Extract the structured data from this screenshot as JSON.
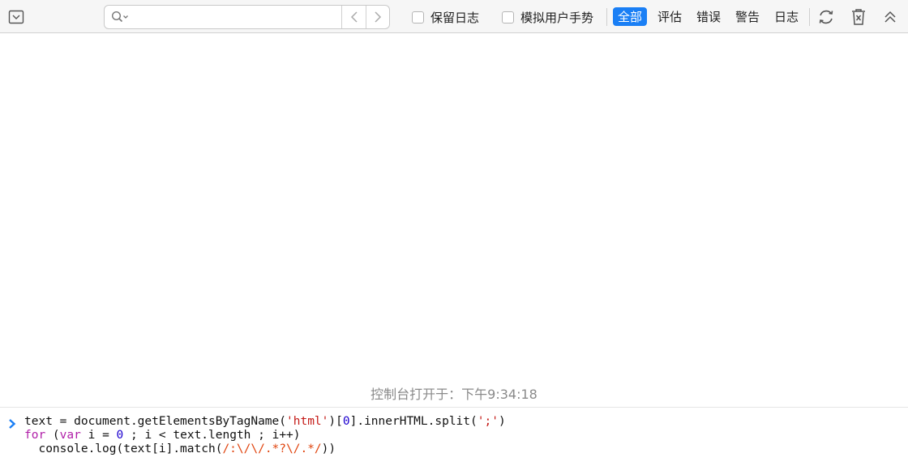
{
  "toolbar": {
    "search": {
      "value": "",
      "placeholder": ""
    },
    "preserve_log_label": "保留日志",
    "simulate_gesture_label": "模拟用户手势",
    "filters": [
      {
        "label": "全部",
        "active": true
      },
      {
        "label": "评估",
        "active": false
      },
      {
        "label": "错误",
        "active": false
      },
      {
        "label": "警告",
        "active": false
      },
      {
        "label": "日志",
        "active": false
      }
    ],
    "icons": {
      "menu": "dropdown-square-icon",
      "search": "magnifier-icon",
      "back": "chevron-left-icon",
      "forward": "chevron-right-icon",
      "reload": "reload-icon",
      "clear": "trash-icon",
      "collapse": "double-chevron-up-icon"
    }
  },
  "status": {
    "message": "控制台打开于：下午9:34:18"
  },
  "console": {
    "prompt_icon": "chevron-right-icon",
    "lines": [
      "text = document.getElementsByTagName('html')[0].innerHTML.split(';')",
      "for (var i = 0 ; i < text.length ; i++)",
      "  console.log(text[i].match(/:\\/\\/.*?\\/.*/))"
    ],
    "tokens": {
      "line1_a": "text = document.getElementsByTagName(",
      "line1_str1": "'html'",
      "line1_b": ")[",
      "line1_num": "0",
      "line1_c": "].innerHTML.split(",
      "line1_str2": "';'",
      "line1_d": ")",
      "line2_kw1": "for",
      "line2_a": " (",
      "line2_kw2": "var",
      "line2_b": " i = ",
      "line2_num": "0",
      "line2_c": " ; i < text.length ; i++)",
      "line3_a": "  console.log(text[i].match(",
      "line3_re": "/:\\/\\/.*?\\/.*/",
      "line3_b": "))"
    }
  },
  "colors": {
    "accent": "#1a7ff5",
    "keyword": "#b01ea8",
    "number": "#1c00cf",
    "string": "#c41a16",
    "regex": "#e0440e",
    "prompt": "#1a7ff5"
  }
}
